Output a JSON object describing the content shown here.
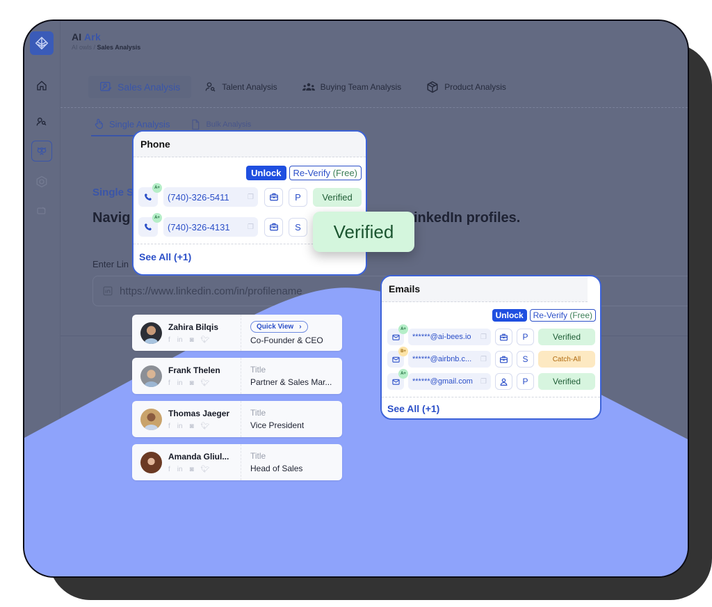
{
  "app": {
    "brand_prefix": "AI",
    "brand_suffix": "Ark",
    "breadcrumb_parent": "AI owls",
    "breadcrumb_sep": " / ",
    "breadcrumb_current": "Sales Analysis"
  },
  "main_tabs": [
    {
      "label": "Sales Analysis",
      "icon": "sales-analysis-icon",
      "active": true
    },
    {
      "label": "Talent Analysis",
      "icon": "talent-search-icon",
      "active": false
    },
    {
      "label": "Buying Team Analysis",
      "icon": "team-icon",
      "active": false
    },
    {
      "label": "Product Analysis",
      "icon": "box-icon",
      "active": false
    }
  ],
  "sub_tabs": [
    {
      "label": "Single Analysis",
      "icon": "pointer-hand-icon",
      "active": true
    },
    {
      "label": "Bulk Analysis",
      "icon": "document-stack-icon",
      "active": false
    }
  ],
  "content": {
    "section_label": "Single S",
    "headline_left": "Navig",
    "headline_right": "inkedIn profiles.",
    "input_label": "Enter Lin",
    "url_placeholder": "https://www.linkedin.com/in/profilename"
  },
  "phone_card": {
    "title": "Phone",
    "unlock_label": "Unlock",
    "reverify_label": "Re-Verify",
    "reverify_free": "(Free)",
    "rows": [
      {
        "grade": "A+",
        "value": "(740)-326-5411",
        "type": "P",
        "status": "Verified"
      },
      {
        "grade": "A+",
        "value": "(740)-326-4131",
        "type": "S",
        "status": "Verified"
      }
    ],
    "see_all": "See All (+1)"
  },
  "verified_popup": "Verified",
  "email_card": {
    "title": "Emails",
    "unlock_label": "Unlock",
    "reverify_label": "Re-Verify",
    "reverify_free": "(Free)",
    "rows": [
      {
        "grade": "A+",
        "value": "******@ai-bees.io",
        "source_icon": "briefcase-icon",
        "type": "P",
        "status": "Verified",
        "status_kind": "verified"
      },
      {
        "grade": "B+",
        "value": "******@airbnb.c...",
        "source_icon": "briefcase-icon",
        "type": "S",
        "status": "Catch-All",
        "status_kind": "catch"
      },
      {
        "grade": "A+",
        "value": "******@gmail.com",
        "source_icon": "person-icon",
        "type": "P",
        "status": "Verified",
        "status_kind": "verified"
      }
    ],
    "see_all": "See All (+1)"
  },
  "people": [
    {
      "name": "Zahira Bilqis",
      "title_label": "Quick View",
      "title": "Co-Founder & CEO",
      "quick_view": true
    },
    {
      "name": "Frank Thelen",
      "title_label": "Title",
      "title": "Partner & Sales Mar...",
      "quick_view": false
    },
    {
      "name": "Thomas Jaeger",
      "title_label": "Title",
      "title": "Vice President",
      "quick_view": false
    },
    {
      "name": "Amanda Gliul...",
      "title_label": "Title",
      "title": "Head of Sales",
      "quick_view": false
    }
  ],
  "colors": {
    "accent": "#1f4fe0",
    "overlay": "#636a82",
    "wave": "#8ea3fb",
    "verified_bg": "#d7f5df",
    "catch_all_bg": "#fde9c2"
  }
}
